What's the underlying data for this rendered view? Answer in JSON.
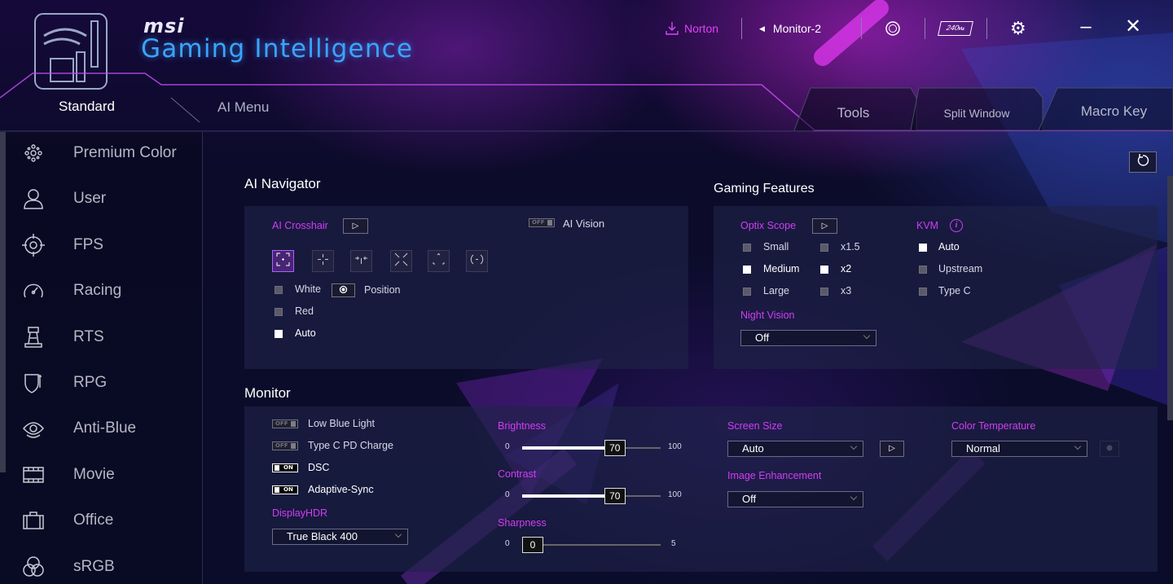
{
  "header": {
    "brand_msi": "msi",
    "brand_title": "Gaming Intelligence",
    "norton": "Norton",
    "monitor": "Monitor-2",
    "rgb_icon": "rgb-icon",
    "hz_label": "240",
    "hz_unit": "Hz",
    "settings_icon": "gear-icon",
    "minimize_icon": "minimize-icon",
    "close_icon": "close-icon"
  },
  "tabs": {
    "standard": "Standard",
    "ai_menu": "AI Menu",
    "tools": "Tools",
    "split_window": "Split Window",
    "macro_key": "Macro Key"
  },
  "sidebar": {
    "items": [
      {
        "label": "Premium Color",
        "icon": "premium-color-icon"
      },
      {
        "label": "User",
        "icon": "user-icon"
      },
      {
        "label": "FPS",
        "icon": "crosshair-icon"
      },
      {
        "label": "Racing",
        "icon": "speedometer-icon"
      },
      {
        "label": "RTS",
        "icon": "tower-icon"
      },
      {
        "label": "RPG",
        "icon": "shield-icon"
      },
      {
        "label": "Anti-Blue",
        "icon": "eye-icon"
      },
      {
        "label": "Movie",
        "icon": "film-icon"
      },
      {
        "label": "Office",
        "icon": "briefcase-icon"
      },
      {
        "label": "sRGB",
        "icon": "rgb-circles-icon"
      }
    ]
  },
  "ai_navigator": {
    "title": "AI Navigator",
    "crosshair_label": "AI Crosshair",
    "ai_vision_toggle": "OFF",
    "ai_vision_label": "AI Vision",
    "colors": [
      {
        "label": "White",
        "checked": false
      },
      {
        "label": "Red",
        "checked": false
      },
      {
        "label": "Auto",
        "checked": true
      }
    ],
    "position_label": "Position"
  },
  "gaming_features": {
    "title": "Gaming Features",
    "optix_scope_label": "Optix Scope",
    "sizes": [
      {
        "label": "Small",
        "checked": false
      },
      {
        "label": "Medium",
        "checked": true
      },
      {
        "label": "Large",
        "checked": false
      }
    ],
    "zooms": [
      {
        "label": "x1.5",
        "checked": false
      },
      {
        "label": "x2",
        "checked": true
      },
      {
        "label": "x3",
        "checked": false
      }
    ],
    "kvm_label": "KVM",
    "kvm_options": [
      {
        "label": "Auto",
        "checked": true
      },
      {
        "label": "Upstream",
        "checked": false
      },
      {
        "label": "Type C",
        "checked": false
      }
    ],
    "night_vision_label": "Night Vision",
    "night_vision_value": "Off"
  },
  "monitor": {
    "title": "Monitor",
    "toggles": [
      {
        "state": "OFF",
        "label": "Low Blue Light"
      },
      {
        "state": "OFF",
        "label": "Type C PD Charge"
      },
      {
        "state": "ON",
        "label": "DSC"
      },
      {
        "state": "ON",
        "label": "Adaptive-Sync"
      }
    ],
    "display_hdr_label": "DisplayHDR",
    "display_hdr_value": "True Black 400",
    "brightness": {
      "label": "Brightness",
      "min": "0",
      "max": "100",
      "value": "70"
    },
    "contrast": {
      "label": "Contrast",
      "min": "0",
      "max": "100",
      "value": "70"
    },
    "sharpness": {
      "label": "Sharpness",
      "min": "0",
      "max": "5",
      "value": "0"
    },
    "screen_size_label": "Screen Size",
    "screen_size_value": "Auto",
    "image_enhancement_label": "Image Enhancement",
    "image_enhancement_value": "Off",
    "color_temperature_label": "Color Temperature",
    "color_temperature_value": "Normal"
  },
  "colors": {
    "accent": "#d33cf5",
    "brand_blue": "#3aa4ff"
  }
}
